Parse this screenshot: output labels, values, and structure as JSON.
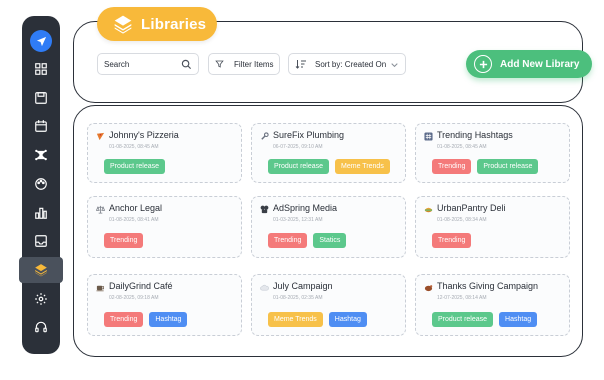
{
  "sidebar": {
    "items": [
      {
        "icon": "send-icon"
      },
      {
        "icon": "grid-icon"
      },
      {
        "icon": "save-icon"
      },
      {
        "icon": "calendar-icon"
      },
      {
        "icon": "network-icon"
      },
      {
        "icon": "palette-icon"
      },
      {
        "icon": "bar-chart-icon"
      },
      {
        "icon": "inbox-icon"
      },
      {
        "icon": "layers-icon",
        "active": true
      },
      {
        "icon": "gear-icon"
      },
      {
        "icon": "headset-icon"
      }
    ]
  },
  "header": {
    "title": "Libraries",
    "search_placeholder": "Search",
    "filter_label": "Filter Items",
    "sort_label": "Sort by: Created On",
    "add_label": "Add New Library"
  },
  "libraries": [
    {
      "name": "Johnny's Pizzeria",
      "date": "01-08-2025, 08:45 AM",
      "icon": "pizza-icon",
      "tags": [
        {
          "label": "Product release",
          "color": "green"
        }
      ]
    },
    {
      "name": "SureFix Plumbing",
      "date": "06-07-2025, 09:10 AM",
      "icon": "wrench-icon",
      "tags": [
        {
          "label": "Product release",
          "color": "green"
        },
        {
          "label": "Meme Trends",
          "color": "yellow"
        }
      ]
    },
    {
      "name": "Trending Hashtags",
      "date": "01-08-2025, 08:45 AM",
      "icon": "hashtag-icon",
      "tags": [
        {
          "label": "Trending",
          "color": "red"
        },
        {
          "label": "Product release",
          "color": "green"
        }
      ]
    },
    {
      "name": "Anchor Legal",
      "date": "01-08-2025, 08:41 AM",
      "icon": "scales-icon",
      "tags": [
        {
          "label": "Trending",
          "color": "red"
        }
      ]
    },
    {
      "name": "AdSpring Media",
      "date": "01-03-2025, 12:31 AM",
      "icon": "media-icon",
      "tags": [
        {
          "label": "Trending",
          "color": "red"
        },
        {
          "label": "Statics",
          "color": "green"
        }
      ]
    },
    {
      "name": "UrbanPantry Deli",
      "date": "01-08-2025, 08:34 AM",
      "icon": "deli-icon",
      "tags": [
        {
          "label": "Trending",
          "color": "red"
        }
      ]
    },
    {
      "name": "DailyGrind Café",
      "date": "02-08-2025, 09:18 AM",
      "icon": "coffee-icon",
      "tags": [
        {
          "label": "Trending",
          "color": "red"
        },
        {
          "label": "Hashtag",
          "color": "blue"
        }
      ]
    },
    {
      "name": "July Campaign",
      "date": "01-08-2025, 02:35 AM",
      "icon": "cloud-icon",
      "tags": [
        {
          "label": "Meme Trends",
          "color": "yellow"
        },
        {
          "label": "Hashtag",
          "color": "blue"
        }
      ]
    },
    {
      "name": "Thanks Giving Campaign",
      "date": "12-07-2025, 08:14 AM",
      "icon": "turkey-icon",
      "tags": [
        {
          "label": "Product release",
          "color": "green"
        },
        {
          "label": "Hashtag",
          "color": "blue"
        }
      ]
    }
  ]
}
